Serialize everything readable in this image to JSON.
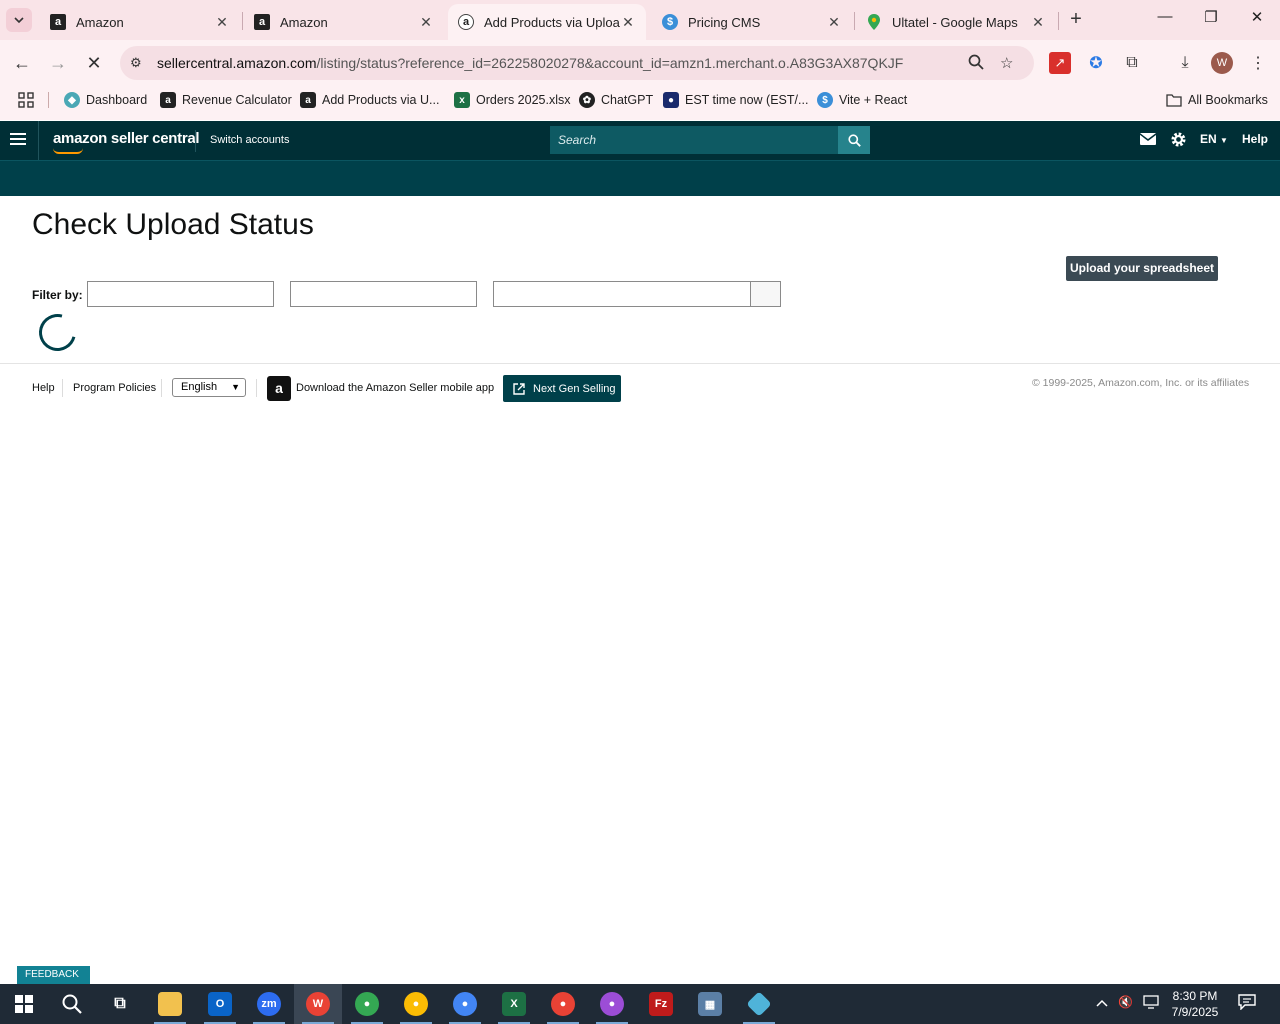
{
  "browser": {
    "tabs": [
      {
        "title": "Amazon",
        "favicon": "amazon-a-icon"
      },
      {
        "title": "Amazon",
        "favicon": "amazon-a-icon"
      },
      {
        "title": "Add Products via Upload",
        "favicon": "seller-central-icon",
        "active": true
      },
      {
        "title": "Pricing CMS",
        "favicon": "dollar-icon"
      },
      {
        "title": "Ultatel - Google Maps",
        "favicon": "map-pin-icon"
      }
    ],
    "url_host": "sellercentral.amazon.com",
    "url_path": "/listing/status?reference_id=262258020278&account_id=amzn1.merchant.o.A83G3AX87QKJF",
    "profile_initial": "W",
    "bookmarks": [
      {
        "label": "Dashboard"
      },
      {
        "label": "Revenue Calculator"
      },
      {
        "label": "Add Products via U..."
      },
      {
        "label": "Orders 2025.xlsx"
      },
      {
        "label": "ChatGPT"
      },
      {
        "label": "EST time now (EST/..."
      },
      {
        "label": "Vite + React"
      }
    ],
    "all_bookmarks": "All Bookmarks"
  },
  "seller_central": {
    "logo_text": "amazon seller central",
    "switch_accounts": "Switch accounts",
    "search_placeholder": "Search",
    "language": "EN",
    "help": "Help"
  },
  "main": {
    "title": "Check Upload Status",
    "upload_button": "Upload your spreadsheet",
    "filter_label": "Filter by:"
  },
  "footer": {
    "help": "Help",
    "program_policies": "Program Policies",
    "language_selected": "English",
    "mobile_app": "Download the Amazon Seller mobile app",
    "next_gen": "Next Gen Selling",
    "copyright": "© 1999-2025, Amazon.com, Inc. or its affiliates"
  },
  "feedback": "FEEDBACK",
  "taskbar": {
    "time": "8:30 PM",
    "date": "7/9/2025"
  },
  "colors": {
    "sc_header": "#002f36",
    "sc_subheader": "#00404a",
    "upload_button": "#3b4a54",
    "feedback": "#128294"
  }
}
